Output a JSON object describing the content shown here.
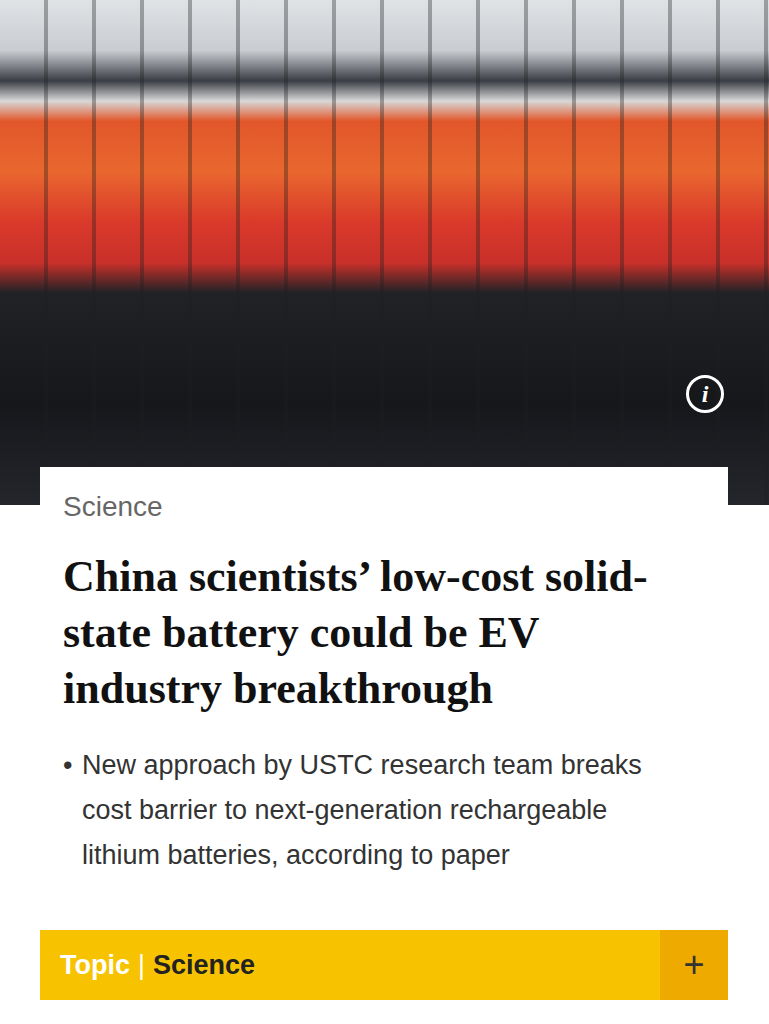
{
  "photo": {
    "info_icon": "i"
  },
  "article": {
    "category": "Science",
    "headline": "China scientists’ low-cost solid-state battery could be EV industry breakthrough",
    "bullets": [
      {
        "marker": "•",
        "text": "New approach by USTC research team breaks cost barrier to next-generation rechargeable lithium batteries, according to paper"
      }
    ]
  },
  "topic_bar": {
    "label": "Topic",
    "separator": "|",
    "value": "Science",
    "button": "+"
  }
}
